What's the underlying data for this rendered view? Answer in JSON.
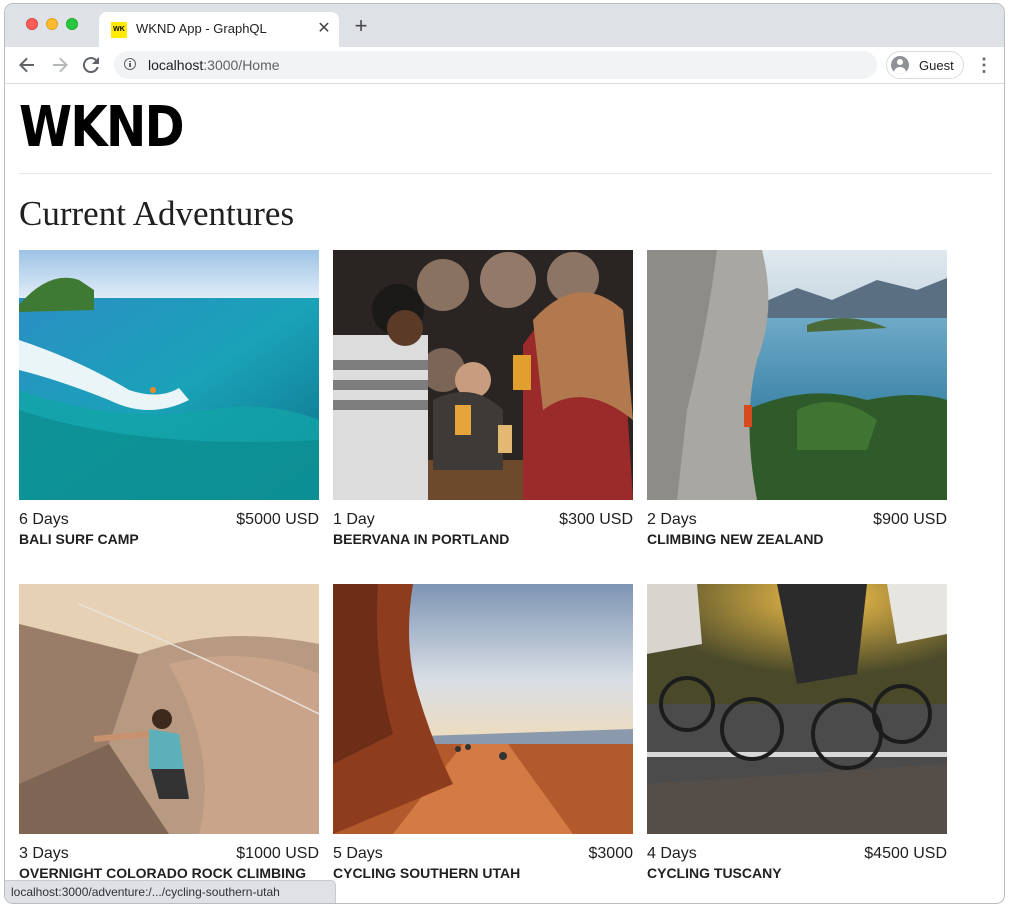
{
  "browser": {
    "tab_title": "WKND App - GraphQL",
    "favicon_text": "WK",
    "url_host": "localhost",
    "url_path": ":3000/Home",
    "profile_label": "Guest",
    "status_url": "localhost:3000/adventure:/.../cycling-southern-utah"
  },
  "site": {
    "logo": "WKND",
    "section_title": "Current Adventures"
  },
  "adventures": [
    {
      "duration": "6 Days",
      "price": "$5000 USD",
      "title": "BALI SURF CAMP"
    },
    {
      "duration": "1 Day",
      "price": "$300 USD",
      "title": "BEERVANA IN PORTLAND"
    },
    {
      "duration": "2 Days",
      "price": "$900 USD",
      "title": "CLIMBING NEW ZEALAND"
    },
    {
      "duration": "3 Days",
      "price": "$1000 USD",
      "title": "OVERNIGHT COLORADO ROCK CLIMBING"
    },
    {
      "duration": "5 Days",
      "price": "$3000",
      "title": "CYCLING SOUTHERN UTAH"
    },
    {
      "duration": "4 Days",
      "price": "$4500 USD",
      "title": "CYCLING TUSCANY"
    }
  ]
}
